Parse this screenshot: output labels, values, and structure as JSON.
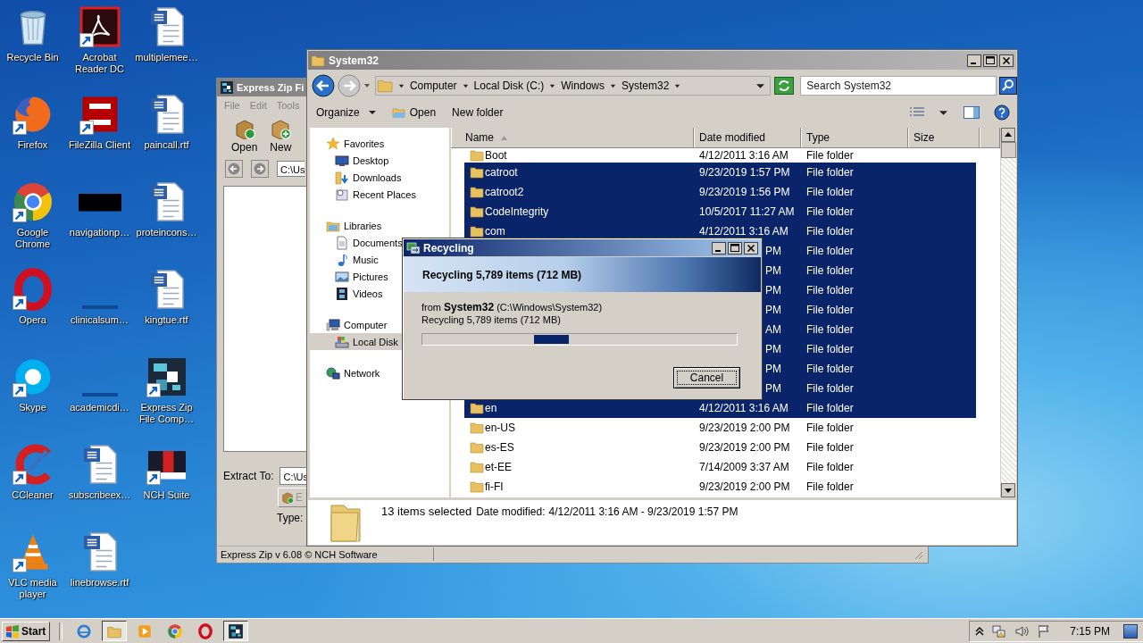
{
  "desktop": {
    "icons": [
      {
        "kind": "recycle",
        "label": "Recycle Bin",
        "shortcut": false
      },
      {
        "kind": "firefox",
        "label": "Firefox",
        "shortcut": true
      },
      {
        "kind": "chrome",
        "label": "Google Chrome",
        "shortcut": true
      },
      {
        "kind": "opera",
        "label": "Opera",
        "shortcut": true
      },
      {
        "kind": "skype",
        "label": "Skype",
        "shortcut": true
      },
      {
        "kind": "ccleaner",
        "label": "CCleaner",
        "shortcut": true
      },
      {
        "kind": "vlc",
        "label": "VLC media player",
        "shortcut": true
      },
      {
        "kind": "acrobat",
        "label": "Acrobat Reader DC",
        "shortcut": true
      },
      {
        "kind": "filezilla",
        "label": "FileZilla Client",
        "shortcut": true
      },
      {
        "kind": "thumb",
        "label": "navigationp…",
        "shortcut": false
      },
      {
        "kind": "blank",
        "label": "clinicalsum…",
        "shortcut": false
      },
      {
        "kind": "blank",
        "label": "academicdi…",
        "shortcut": false
      },
      {
        "kind": "word",
        "label": "subscribeex…",
        "shortcut": false
      },
      {
        "kind": "word",
        "label": "linebrowse.rtf",
        "shortcut": false
      },
      {
        "kind": "word",
        "label": "multiplemee…",
        "shortcut": false
      },
      {
        "kind": "word",
        "label": "paincall.rtf",
        "shortcut": false
      },
      {
        "kind": "word",
        "label": "proteincons…",
        "shortcut": false
      },
      {
        "kind": "word",
        "label": "kingtue.rtf",
        "shortcut": false
      },
      {
        "kind": "expresszip",
        "label": "Express Zip File Comp…",
        "shortcut": true
      },
      {
        "kind": "nch",
        "label": "NCH Suite",
        "shortcut": true
      }
    ]
  },
  "express_zip": {
    "title": "Express Zip Fi",
    "menu": [
      "File",
      "Edit",
      "Tools"
    ],
    "toolbar": [
      {
        "kind": "open",
        "label": "Open"
      },
      {
        "kind": "new",
        "label": "New"
      }
    ],
    "path": "C:\\Us",
    "extract_label": "Extract To:",
    "extract_path": "C:\\Us",
    "extract_button": "E",
    "type_label": "Type:",
    "status": "Express Zip v 6.08 © NCH Software"
  },
  "explorer": {
    "title": "System32",
    "breadcrumb": [
      "Computer",
      "Local Disk (C:)",
      "Windows",
      "System32"
    ],
    "search": {
      "placeholder": "Search System32"
    },
    "commands": [
      {
        "kind": "menu",
        "label": "Organize"
      },
      {
        "kind": "open",
        "label": "Open"
      },
      {
        "kind": "plain",
        "label": "New folder"
      }
    ],
    "nav": [
      {
        "kind": "star",
        "label": "Favorites",
        "selected": false,
        "children": [
          {
            "kind": "desktop",
            "label": "Desktop",
            "selected": false
          },
          {
            "kind": "downloads",
            "label": "Downloads",
            "selected": false
          },
          {
            "kind": "recent",
            "label": "Recent Places",
            "selected": false
          }
        ]
      },
      {
        "kind": "libraries",
        "label": "Libraries",
        "selected": false,
        "children": [
          {
            "kind": "documents",
            "label": "Documents",
            "selected": false
          },
          {
            "kind": "music",
            "label": "Music",
            "selected": false
          },
          {
            "kind": "pictures",
            "label": "Pictures",
            "selected": false
          },
          {
            "kind": "videos",
            "label": "Videos",
            "selected": false
          }
        ]
      },
      {
        "kind": "computer",
        "label": "Computer",
        "selected": false,
        "children": [
          {
            "kind": "disk",
            "label": "Local Disk",
            "selected": true
          }
        ]
      },
      {
        "kind": "network",
        "label": "Network",
        "selected": false
      }
    ],
    "columns": [
      {
        "label": "Name",
        "sorted": true
      },
      {
        "label": "Date modified",
        "sorted": false
      },
      {
        "label": "Type",
        "sorted": false
      },
      {
        "label": "Size",
        "sorted": false
      }
    ],
    "rows": [
      {
        "kind": "folder",
        "name": "Boot",
        "date": "4/12/2011 3:16 AM",
        "type": "File folder",
        "selected": false
      },
      {
        "kind": "folder",
        "name": "catroot",
        "date": "9/23/2019 1:57 PM",
        "type": "File folder",
        "selected": true
      },
      {
        "kind": "folder",
        "name": "catroot2",
        "date": "9/23/2019 1:56 PM",
        "type": "File folder",
        "selected": true
      },
      {
        "kind": "folder",
        "name": "CodeIntegrity",
        "date": "10/5/2017 11:27 AM",
        "type": "File folder",
        "selected": true
      },
      {
        "kind": "folder",
        "name": "com",
        "date": "4/12/2011 3:16 AM",
        "type": "File folder",
        "selected": true
      },
      {
        "kind": "covered",
        "date": "PM",
        "type": "File folder",
        "selected": true
      },
      {
        "kind": "covered",
        "date": "PM",
        "type": "File folder",
        "selected": true
      },
      {
        "kind": "covered",
        "date": "PM",
        "type": "File folder",
        "selected": true
      },
      {
        "kind": "covered",
        "date": "PM",
        "type": "File folder",
        "selected": true
      },
      {
        "kind": "covered",
        "date": "AM",
        "type": "File folder",
        "selected": true
      },
      {
        "kind": "covered",
        "date": "PM",
        "type": "File folder",
        "selected": true
      },
      {
        "kind": "covered",
        "date": "PM",
        "type": "File folder",
        "selected": true
      },
      {
        "kind": "covered",
        "date": "PM",
        "type": "File folder",
        "selected": true
      },
      {
        "kind": "folder",
        "name": "en",
        "date": "4/12/2011 3:16 AM",
        "type": "File folder",
        "selected": true
      },
      {
        "kind": "folder",
        "name": "en-US",
        "date": "9/23/2019 2:00 PM",
        "type": "File folder",
        "selected": false
      },
      {
        "kind": "folder",
        "name": "es-ES",
        "date": "9/23/2019 2:00 PM",
        "type": "File folder",
        "selected": false
      },
      {
        "kind": "folder",
        "name": "et-EE",
        "date": "7/14/2009 3:37 AM",
        "type": "File folder",
        "selected": false
      },
      {
        "kind": "folder",
        "name": "fi-FI",
        "date": "9/23/2019 2:00 PM",
        "type": "File folder",
        "selected": false
      }
    ],
    "details": {
      "count": "13 items selected",
      "date_label": "Date modified:",
      "date_range": "4/12/2011 3:16 AM - 9/23/2019 1:57 PM"
    }
  },
  "dialog": {
    "title": "Recycling",
    "heading": "Recycling 5,789 items (712 MB)",
    "from": "from **System32** (C:\\Windows\\System32)",
    "status": "Recycling 5,789 items (712 MB)",
    "progress": {
      "indeterminate": true
    },
    "button": "Cancel"
  },
  "taskbar": {
    "start": "Start",
    "items": [
      {
        "kind": "ie",
        "active": false
      },
      {
        "kind": "explorer",
        "active": true
      },
      {
        "kind": "media",
        "active": false
      },
      {
        "kind": "chrome",
        "active": false
      },
      {
        "kind": "opera",
        "active": false
      },
      {
        "kind": "expresszip",
        "active": true
      }
    ],
    "clock": "7:15 PM"
  }
}
